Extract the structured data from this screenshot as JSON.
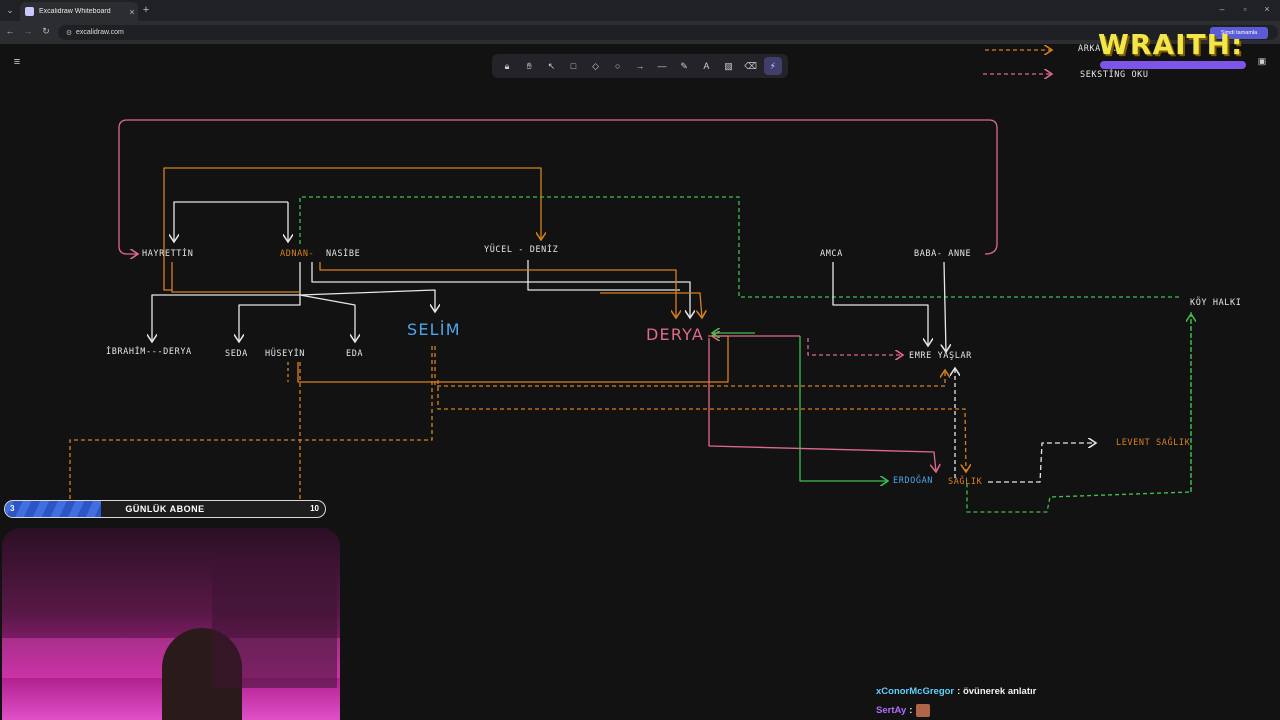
{
  "browser": {
    "tab_title": "Excalidraw Whiteboard",
    "url": "excalidraw.com",
    "share_label": "Şimdi tamamla"
  },
  "toolbar": {
    "tools": [
      "lock",
      "hand",
      "selection",
      "rectangle",
      "diamond",
      "ellipse",
      "arrow",
      "line",
      "pencil",
      "text",
      "image",
      "eraser",
      "laser"
    ],
    "active": "laser"
  },
  "legend": {
    "items": [
      {
        "label": "ARKA...",
        "color": "#e0801f"
      },
      {
        "label": "SEKSTİNG OKU",
        "color": "#e06a8a"
      }
    ]
  },
  "watermark": "WRAITH:",
  "nodes": {
    "hayrettin": "HAYRETTİN",
    "adnan": "ADNAN-",
    "nasibe": "NASİBE",
    "yucel_deniz": "YÜCEL - DENİZ",
    "amca": "AMCA",
    "baba_anne": "BABA- ANNE",
    "ibrahim_derya": "İBRAHİM---DERYA",
    "seda": "SEDA",
    "huseyin": "HÜSEYİN",
    "eda": "EDA",
    "selim": "SELİM",
    "derya": "DERYA",
    "emre_yaslar": "EMRE YAŞLAR",
    "koy_halki": "KÖY HALKI",
    "levent_saglik": "LEVENT SAĞLIK",
    "erdogan": "ERDOĞAN",
    "saglik": "SAĞLIK"
  },
  "colors": {
    "white": "#e6e6e6",
    "orange": "#d8801f",
    "pink": "#e06a8a",
    "green": "#3fbf4f",
    "blue": "#4ea6ee"
  },
  "sub_goal": {
    "label": "GÜNLÜK ABONE",
    "current": "3",
    "goal": "10",
    "progress": 0.3
  },
  "chat": [
    {
      "user": "xConorMcGregor",
      "message": "övünerek anlatır",
      "user_color": "#5fd0ff"
    },
    {
      "user": "SertAy",
      "message": "",
      "user_color": "#b06cff"
    }
  ]
}
